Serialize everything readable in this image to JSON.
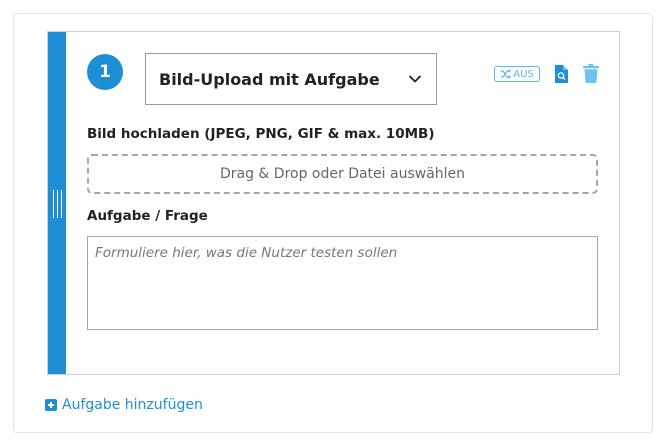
{
  "task": {
    "number": "1",
    "type_selected": "Bild-Upload mit Aufgabe",
    "shuffle_label": "AUS",
    "upload_label": "Bild hochladen (JPEG, PNG, GIF & max. 10MB)",
    "upload_dropzone_text": "Drag & Drop oder Datei auswählen",
    "question_label": "Aufgabe / Frage",
    "question_placeholder": "Formuliere hier, was die Nutzer testen sollen",
    "question_value": ""
  },
  "footer": {
    "add_task_label": "Aufgabe hinzufügen"
  },
  "icons": {
    "shuffle": "shuffle-icon",
    "preview": "preview-icon",
    "delete": "trash-icon",
    "dropdown": "chevron-down-icon",
    "add": "plus-square-icon",
    "drag": "drag-handle-icon"
  },
  "colors": {
    "accent": "#1e8fd6",
    "accent_light": "#5cb8ec",
    "border": "#a6a6a6"
  }
}
